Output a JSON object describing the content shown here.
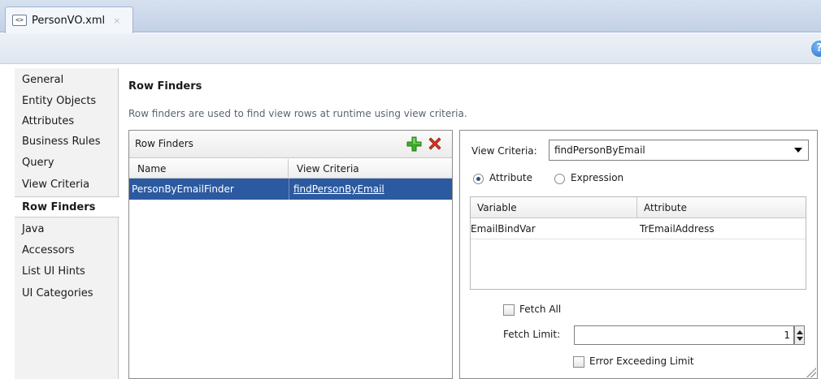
{
  "editor": {
    "tab_title": "PersonVO.xml",
    "tab_close": "×",
    "file_icon": "xml-file-icon",
    "help_icon": "?"
  },
  "nav": {
    "items": [
      {
        "label": "General"
      },
      {
        "label": "Entity Objects"
      },
      {
        "label": "Attributes"
      },
      {
        "label": "Business Rules"
      },
      {
        "label": "Query"
      },
      {
        "label": "View Criteria"
      },
      {
        "label": "Row Finders"
      },
      {
        "label": "Java"
      },
      {
        "label": "Accessors"
      },
      {
        "label": "List UI Hints"
      },
      {
        "label": "UI Categories"
      }
    ],
    "active": "Row Finders"
  },
  "main": {
    "title": "Row Finders",
    "description": "Row finders are used to find view rows at runtime using view criteria."
  },
  "row_finders": {
    "panel_title": "Row Finders",
    "columns": [
      "Name",
      "View Criteria"
    ],
    "rows": [
      {
        "name": "PersonByEmailFinder",
        "view_criteria": "findPersonByEmail"
      }
    ],
    "add_icon": "add-icon",
    "delete_icon": "delete-icon"
  },
  "detail": {
    "view_criteria_label": "View Criteria:",
    "view_criteria_value": "findPersonByEmail",
    "radio_attribute": "Attribute",
    "radio_expression": "Expression",
    "selected_mode": "Attribute",
    "table_columns": [
      "Variable",
      "Attribute"
    ],
    "table_rows": [
      {
        "variable": "EmailBindVar",
        "attribute": "TrEmailAddress"
      }
    ],
    "fetch_all_label": "Fetch All",
    "fetch_all_checked": false,
    "fetch_limit_label": "Fetch Limit:",
    "fetch_limit_value": "1",
    "error_label": "Error Exceeding Limit",
    "error_checked": false
  },
  "colors": {
    "selection": "#2c5aa0",
    "tab_strip": "#c3d1e6"
  }
}
